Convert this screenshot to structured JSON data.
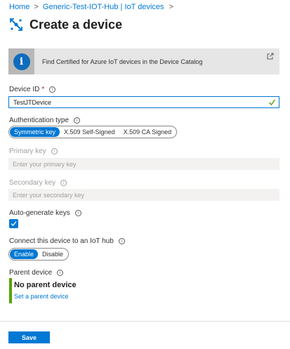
{
  "breadcrumb": {
    "items": [
      "Home",
      "Generic-Test-IOT-Hub | IoT devices"
    ],
    "separator": ">"
  },
  "page": {
    "title": "Create a device",
    "icon": "iot-device-icon"
  },
  "banner": {
    "icon": "info-icon",
    "text": "Find Certified for Azure IoT devices in the Device Catalog",
    "link_icon": "external-link-icon"
  },
  "device_id": {
    "label": "Device ID",
    "required": "*",
    "value": "TestJTDevice"
  },
  "auth_type": {
    "label": "Authentication type",
    "options": [
      "Symmetric key",
      "X.509 Self-Signed",
      "X.509 CA Signed"
    ],
    "selected": "Symmetric key"
  },
  "primary_key": {
    "label": "Primary key",
    "placeholder": "Enter your primary key"
  },
  "secondary_key": {
    "label": "Secondary key",
    "placeholder": "Enter your secondary key"
  },
  "auto_generate": {
    "label": "Auto-generate keys",
    "checked": true
  },
  "connect_hub": {
    "label": "Connect this device to an IoT hub",
    "options": [
      "Enable",
      "Disable"
    ],
    "selected": "Enable"
  },
  "parent_device": {
    "label": "Parent device",
    "value": "No parent device",
    "link": "Set a parent device"
  },
  "footer": {
    "save_label": "Save"
  },
  "colors": {
    "accent": "#0078d4",
    "success": "#57a300",
    "required": "#a4262c"
  }
}
